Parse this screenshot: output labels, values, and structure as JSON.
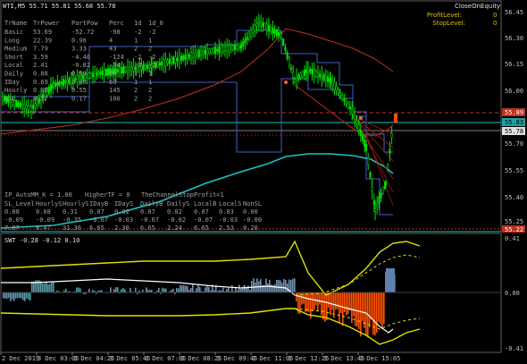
{
  "header": {
    "symbol_line": "WTI,M5  55.71 55.81 55.68 55.78",
    "close_on_equity": "CloseOnEquity",
    "profit_level_label": "ProfitLevel:",
    "profit_level_value": "0",
    "stop_level_label": "StopLevel:",
    "stop_level_value": "0"
  },
  "trend_table": {
    "headers": [
      "TrName",
      "TrPower",
      "PartPow",
      "Perc",
      "1d",
      "1d_0"
    ],
    "rows": [
      [
        "Basic",
        "53.69",
        "-52.72",
        "-98",
        "-2",
        "-2"
      ],
      [
        "Long",
        "22.39",
        "0.96",
        "4",
        "1",
        "1"
      ],
      [
        "Medium",
        "7.79",
        "3.33",
        "43",
        "2",
        "2"
      ],
      [
        "Short",
        "3.59",
        "-4.46",
        "-124",
        "-2",
        "-2"
      ],
      [
        "Local",
        "2.41",
        "-0.82",
        "-34",
        "-2",
        "-2"
      ],
      [
        "Daily",
        "0.88",
        "0.59",
        "66",
        "1",
        "1"
      ],
      [
        "IDay",
        "0.69",
        "0.48",
        "69",
        "1",
        "1"
      ],
      [
        "Hourly",
        "0.38",
        "0.55",
        "145",
        "2",
        "2"
      ],
      [
        "NSL",
        "0.17",
        "0.17",
        "100",
        "2",
        "2"
      ]
    ]
  },
  "mm_line": {
    "left": "IP_AutoMM_K = 1.00",
    "mid": "HigherTF = 0",
    "right": "TheChannelStopProfit=1"
  },
  "sl_table": {
    "headers": [
      "SL_Level",
      "HourlyS",
      "HourlyS",
      "IDayB",
      "IDayS",
      "DailyB",
      "DailyS",
      "LocalB",
      "LocalS",
      "NonSL"
    ],
    "rows": [
      [
        "0.08",
        "0.08",
        "0.31",
        "0.07",
        "0.02",
        "0.07",
        "0.02",
        "0.07",
        "0.03",
        "0.00"
      ],
      [
        "-0.09",
        "-0.09",
        "-0.35",
        "-0.07",
        "-0.03",
        "-0.07",
        "-0.02",
        "-0.07",
        "-0.03",
        "-0.00"
      ],
      [
        "7.87",
        "8.47",
        "31.36",
        "6.65",
        "2.30",
        "6.65",
        "2.24",
        "6.65",
        "2.53",
        "0.20"
      ]
    ]
  },
  "price_axis": {
    "ticks": [
      "56.45",
      "56.30",
      "56.15",
      "56.00",
      "55.85",
      "55.70",
      "55.55",
      "55.40",
      "55.25"
    ],
    "marker_red": "55.89",
    "marker_teal": "55.83",
    "marker_white": "55.78",
    "marker_red_bottom": "55.22"
  },
  "indicator": {
    "label": "SWT -0.28 -0.12 0.10",
    "ticks": [
      "0.41",
      "0.00",
      "-0.41"
    ]
  },
  "time_axis": {
    "ticks": [
      "2 Dec 2019",
      "3 Dec 03:05",
      "3 Dec 04:25",
      "3 Dec 05:45",
      "3 Dec 07:05",
      "3 Dec 08:25",
      "3 Dec 09:45",
      "3 Dec 11:05",
      "3 Dec 12:25",
      "3 Dec 13:45",
      "3 Dec 15:05"
    ]
  },
  "colors": {
    "candle_up": "#00e000",
    "candle_down": "#00e000",
    "ma_cyan": "#20c0c0",
    "ma_red": "#c03020",
    "channel_blue": "#4060c0",
    "band_yellow": "#e0e000",
    "hist_orange": "#ff5000",
    "hist_steel": "#7090b0",
    "hist_teal": "#40a0a0",
    "grid_red_dash": "#c03020"
  }
}
